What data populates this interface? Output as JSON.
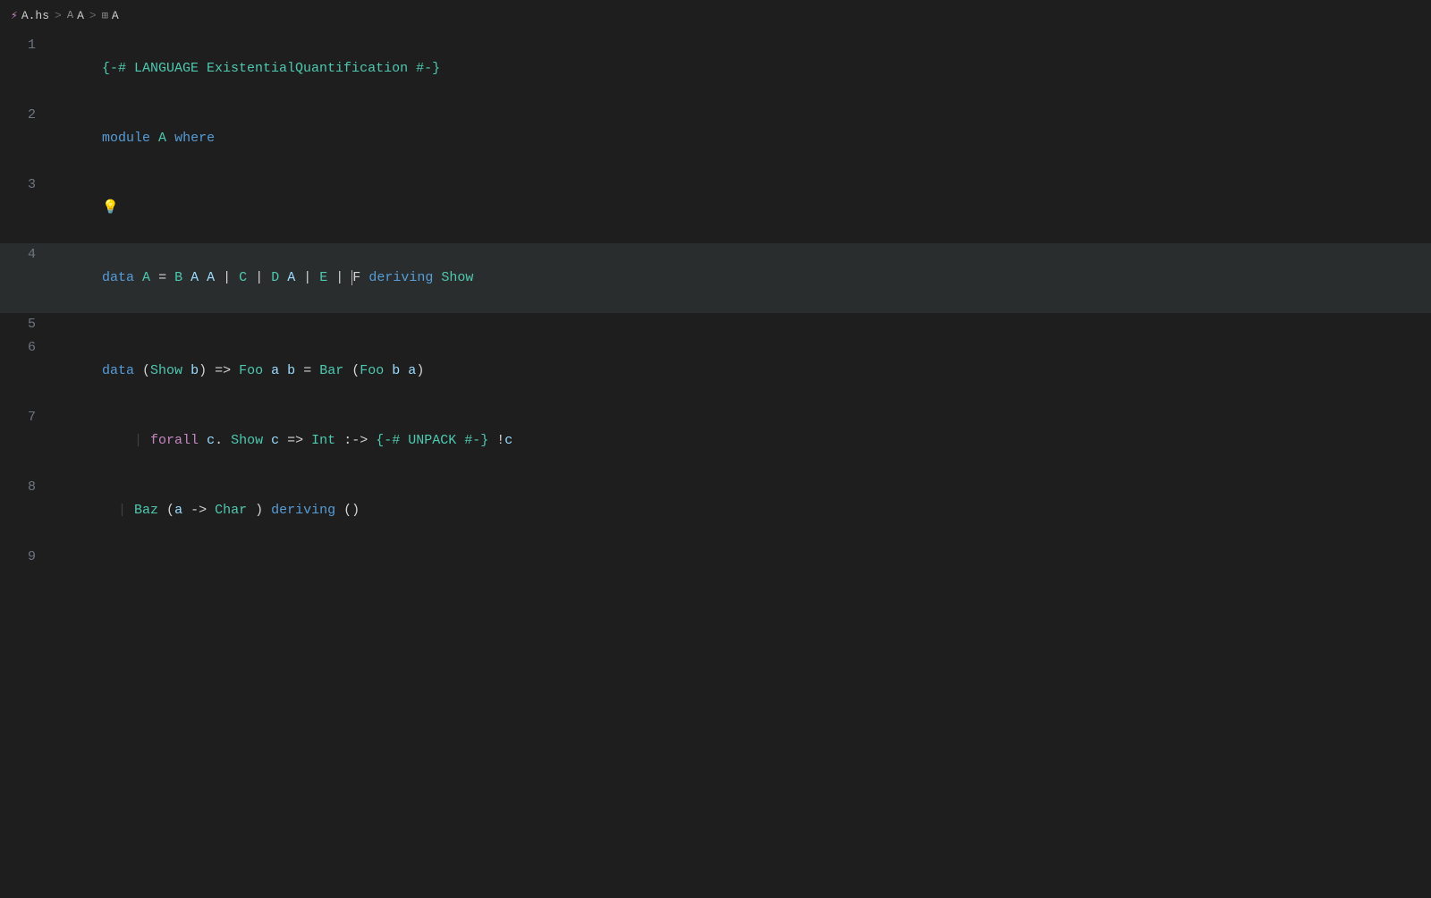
{
  "breadcrumb": {
    "file_icon": "⚡",
    "file_name": "A.hs",
    "sep1": ">",
    "module_icon": "A",
    "module_name": "A",
    "sep2": ">",
    "symbol_icon": "⊞",
    "symbol_name": "A"
  },
  "lines": [
    {
      "num": "1",
      "tokens": [
        {
          "t": "pragma",
          "v": "{-# LANGUAGE ExistentialQuantification #-}"
        }
      ]
    },
    {
      "num": "2",
      "tokens": [
        {
          "t": "kw",
          "v": "module"
        },
        {
          "t": "plain",
          "v": " "
        },
        {
          "t": "type",
          "v": "A"
        },
        {
          "t": "plain",
          "v": " "
        },
        {
          "t": "kw",
          "v": "where"
        }
      ]
    },
    {
      "num": "3",
      "tokens": [
        {
          "t": "lightbulb",
          "v": "💡"
        }
      ]
    },
    {
      "num": "4",
      "tokens": [
        {
          "t": "kw",
          "v": "data"
        },
        {
          "t": "plain",
          "v": " "
        },
        {
          "t": "type",
          "v": "A"
        },
        {
          "t": "plain",
          "v": " = "
        },
        {
          "t": "ctor",
          "v": "B"
        },
        {
          "t": "plain",
          "v": " "
        },
        {
          "t": "tv",
          "v": "A"
        },
        {
          "t": "plain",
          "v": " "
        },
        {
          "t": "tv",
          "v": "A"
        },
        {
          "t": "plain",
          "v": " | "
        },
        {
          "t": "ctor",
          "v": "C"
        },
        {
          "t": "plain",
          "v": " | "
        },
        {
          "t": "ctor",
          "v": "D"
        },
        {
          "t": "plain",
          "v": " "
        },
        {
          "t": "tv",
          "v": "A"
        },
        {
          "t": "plain",
          "v": " | "
        },
        {
          "t": "ctor",
          "v": "E"
        },
        {
          "t": "plain",
          "v": " | "
        },
        {
          "t": "cursor",
          "v": "F"
        },
        {
          "t": "plain",
          "v": " "
        },
        {
          "t": "kw",
          "v": "deriving"
        },
        {
          "t": "plain",
          "v": " "
        },
        {
          "t": "type",
          "v": "Show"
        }
      ],
      "cursor": true
    },
    {
      "num": "5",
      "tokens": []
    },
    {
      "num": "6",
      "tokens": [
        {
          "t": "kw",
          "v": "data"
        },
        {
          "t": "plain",
          "v": " ("
        },
        {
          "t": "type",
          "v": "Show"
        },
        {
          "t": "plain",
          "v": " "
        },
        {
          "t": "tv",
          "v": "b"
        },
        {
          "t": "plain",
          "v": ") => "
        },
        {
          "t": "type",
          "v": "Foo"
        },
        {
          "t": "plain",
          "v": " "
        },
        {
          "t": "tv",
          "v": "a"
        },
        {
          "t": "plain",
          "v": " "
        },
        {
          "t": "tv",
          "v": "b"
        },
        {
          "t": "plain",
          "v": " = "
        },
        {
          "t": "ctor",
          "v": "Bar"
        },
        {
          "t": "plain",
          "v": " ("
        },
        {
          "t": "type",
          "v": "Foo"
        },
        {
          "t": "plain",
          "v": " "
        },
        {
          "t": "tv",
          "v": "b"
        },
        {
          "t": "plain",
          "v": " "
        },
        {
          "t": "tv",
          "v": "a"
        },
        {
          "t": "plain",
          "v": ")"
        }
      ]
    },
    {
      "num": "7",
      "tokens": [
        {
          "t": "dim",
          "v": "    | "
        },
        {
          "t": "forall-kw",
          "v": "forall"
        },
        {
          "t": "plain",
          "v": " "
        },
        {
          "t": "tv",
          "v": "c"
        },
        {
          "t": "dot",
          "v": "."
        },
        {
          "t": "plain",
          "v": " "
        },
        {
          "t": "type",
          "v": "Show"
        },
        {
          "t": "plain",
          "v": " "
        },
        {
          "t": "tv",
          "v": "c"
        },
        {
          "t": "plain",
          "v": " => "
        },
        {
          "t": "type",
          "v": "Int"
        },
        {
          "t": "plain",
          "v": " :-> "
        },
        {
          "t": "pragma",
          "v": "{-# UNPACK #-}"
        },
        {
          "t": "plain",
          "v": " !"
        },
        {
          "t": "tv",
          "v": "c"
        }
      ]
    },
    {
      "num": "8",
      "tokens": [
        {
          "t": "dim",
          "v": "  | "
        },
        {
          "t": "ctor",
          "v": "Baz"
        },
        {
          "t": "plain",
          "v": " ("
        },
        {
          "t": "tv",
          "v": "a"
        },
        {
          "t": "plain",
          "v": " -> "
        },
        {
          "t": "type",
          "v": "Char"
        },
        {
          "t": "plain",
          "v": " ) "
        },
        {
          "t": "kw",
          "v": "deriving"
        },
        {
          "t": "plain",
          "v": " ()"
        }
      ]
    },
    {
      "num": "9",
      "tokens": []
    }
  ]
}
